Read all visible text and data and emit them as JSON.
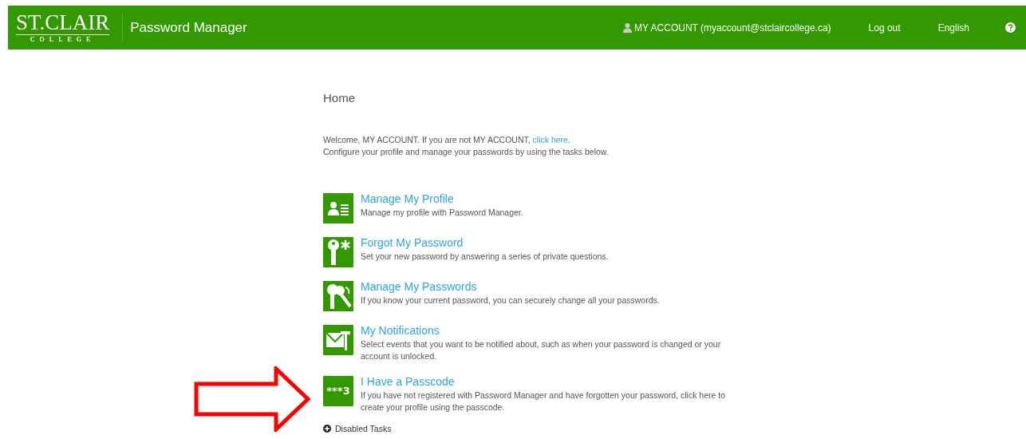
{
  "header": {
    "logo": {
      "name": "ST.CLAIR",
      "sub": "COLLEGE"
    },
    "app_title": "Password Manager",
    "account": "MY ACCOUNT (myaccount@stclaircollege.ca)",
    "logout": "Log out",
    "language": "English"
  },
  "page_title": "Home",
  "welcome": {
    "before": "Welcome, MY ACCOUNT. If you are not MY ACCOUNT, ",
    "link": "click here",
    "after": ".",
    "line2": "Configure your profile and manage your passwords by using the tasks below."
  },
  "tasks": [
    {
      "kind": "profile",
      "title": "Manage My Profile",
      "description": "Manage my profile with Password Manager.",
      "highlighted": false
    },
    {
      "kind": "key",
      "title": "Forgot My Password",
      "description": "Set your new password by answering a series of private questions.",
      "highlighted": false
    },
    {
      "kind": "keys",
      "title": "Manage My Passwords",
      "description": "If you know your current password, you can securely change all your passwords.",
      "highlighted": false
    },
    {
      "kind": "mail",
      "title": "My Notifications",
      "description": "Select events that you want to be notified about, such as when your password is changed or your account is unlocked.",
      "highlighted": false
    },
    {
      "kind": "passcode",
      "icon_text": "***3",
      "title": "I Have a Passcode",
      "description": "If you have not registered with Password Manager and have forgotten your password, click here to create your profile using the passcode.",
      "highlighted": true
    }
  ],
  "disabled_tasks": {
    "label": "Disabled Tasks",
    "expanded": false
  }
}
